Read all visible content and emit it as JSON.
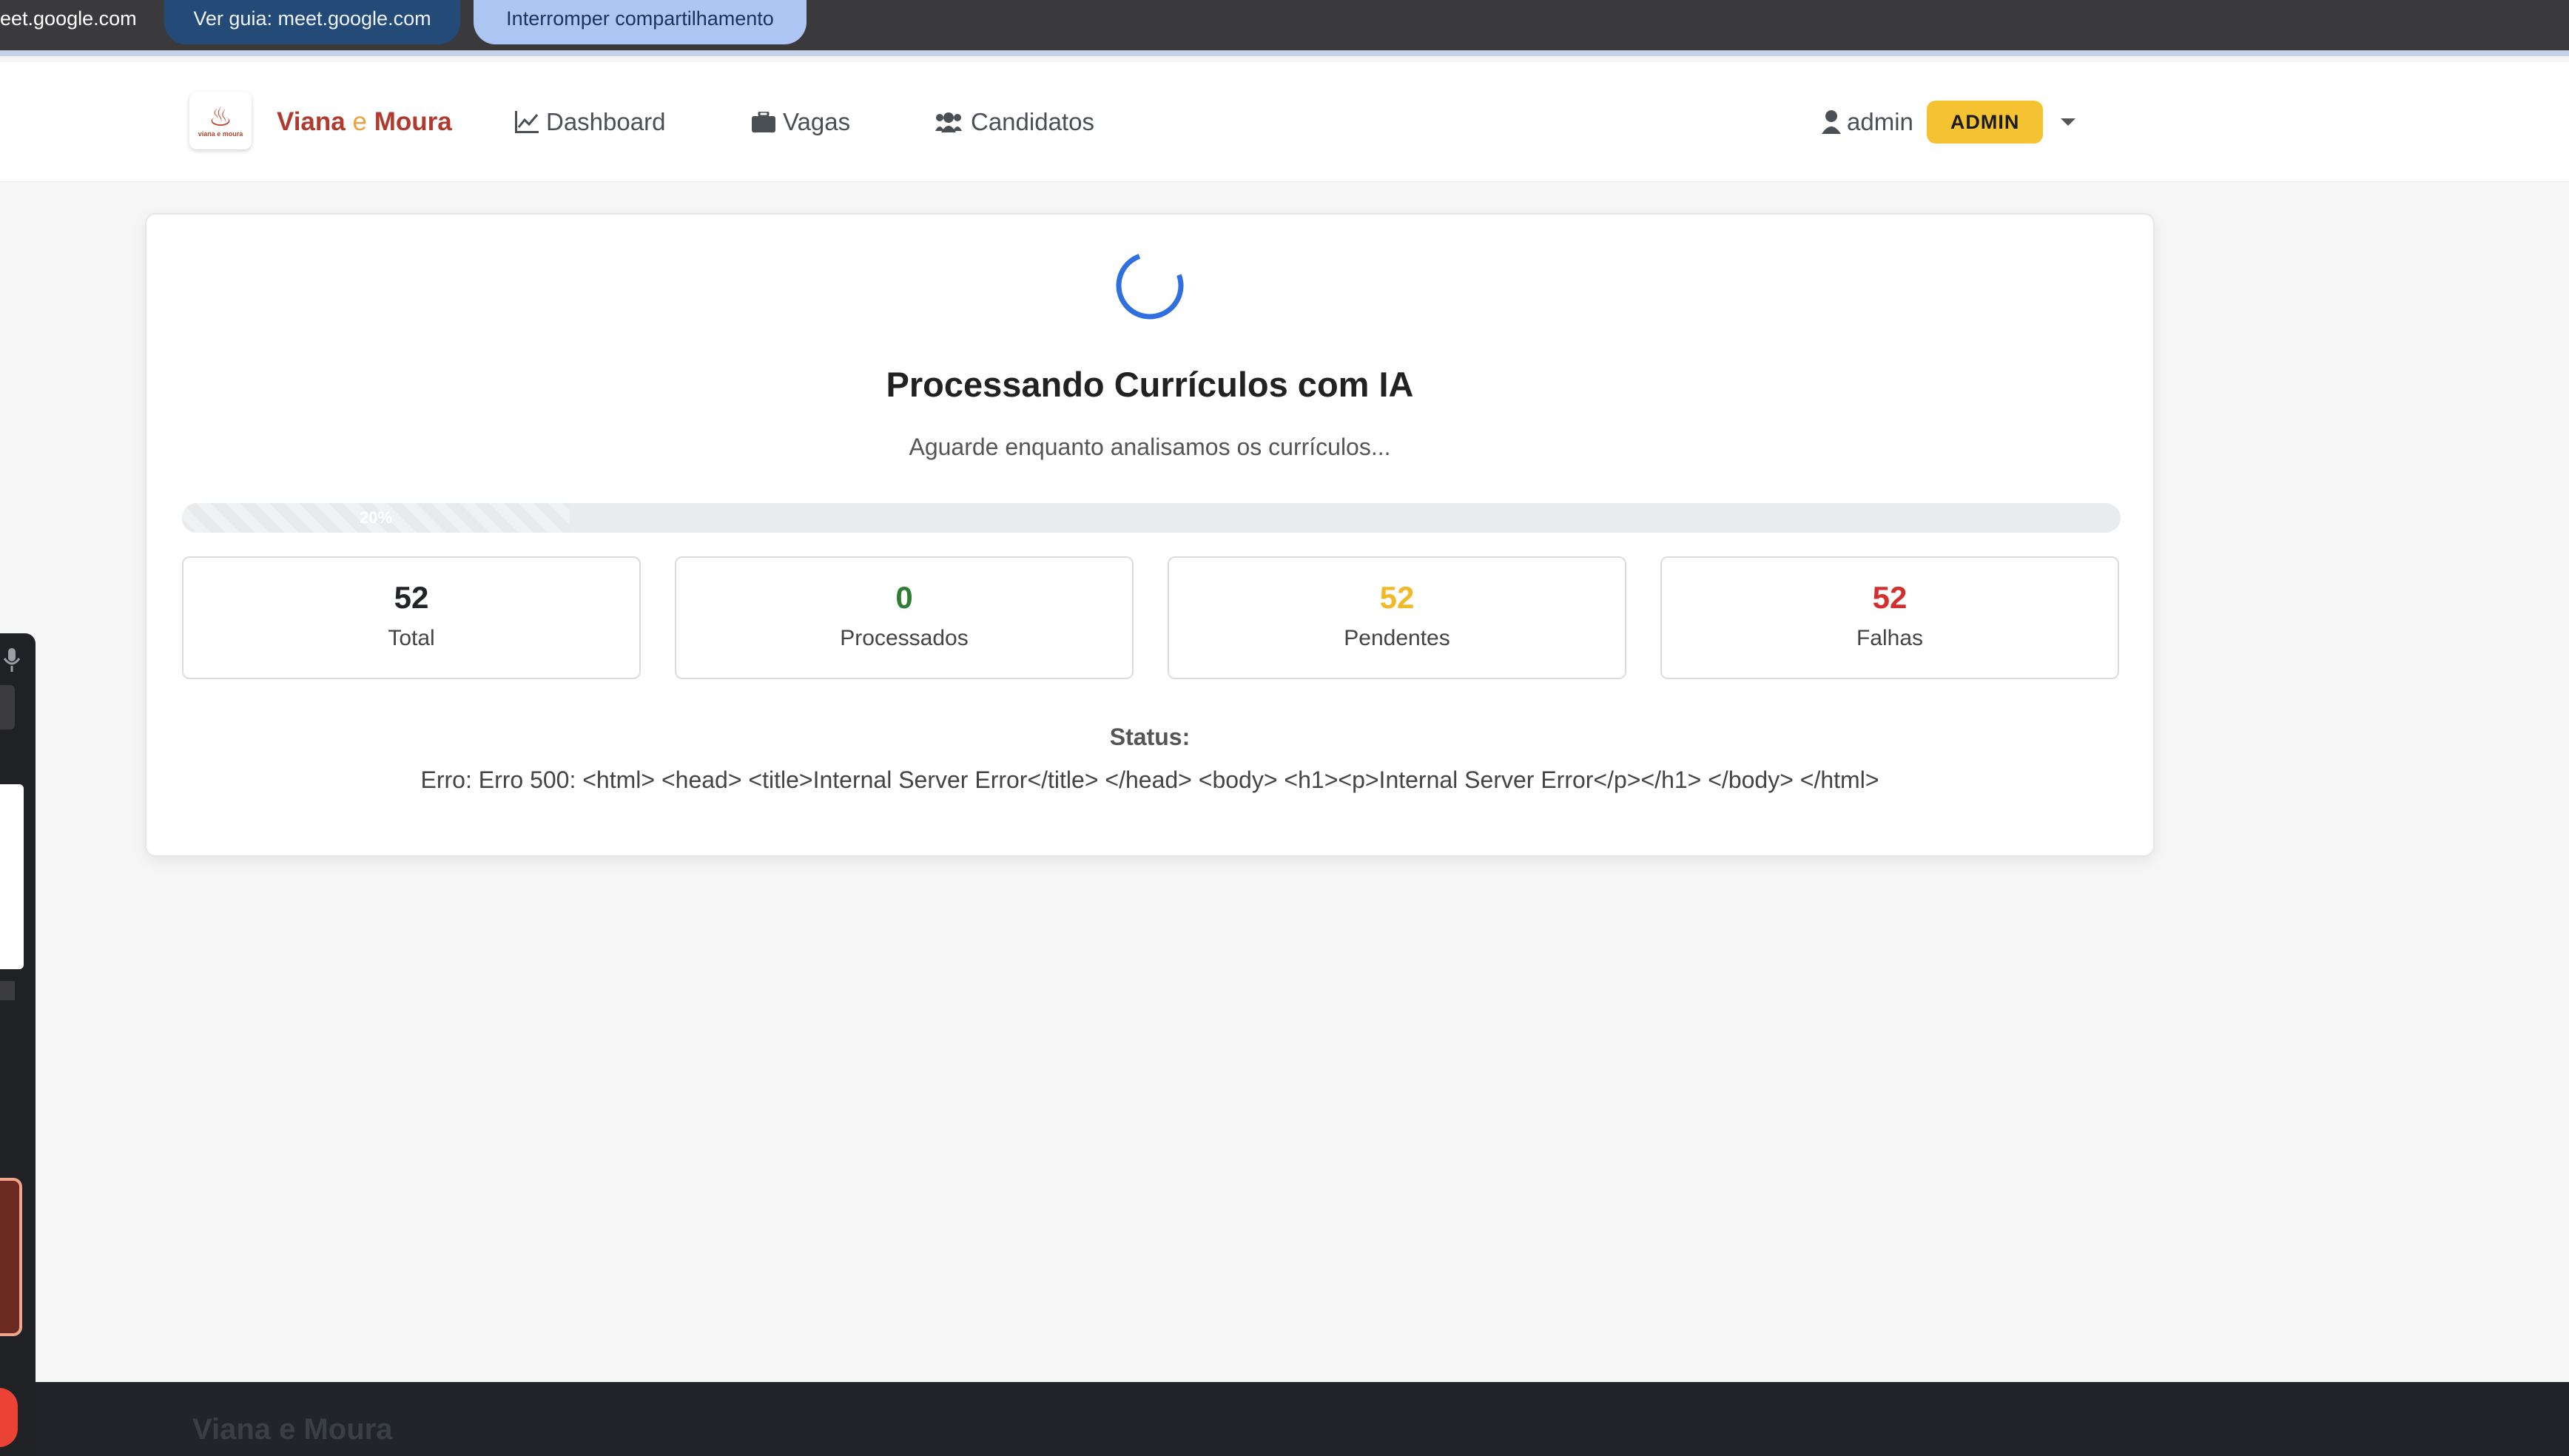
{
  "share_bar": {
    "sharing_text": "eet.google.com",
    "guide_label": "Ver guia: meet.google.com",
    "stop_label": "Interromper compartilhamento"
  },
  "navbar": {
    "logo_text": "viana e moura",
    "brand_part1": "Viana",
    "brand_part2": "e",
    "brand_part3": "Moura",
    "items": [
      {
        "label": "Dashboard",
        "icon": "chart-line-icon"
      },
      {
        "label": "Vagas",
        "icon": "briefcase-icon"
      },
      {
        "label": "Candidatos",
        "icon": "users-icon"
      }
    ],
    "user_name": "admin",
    "role_badge": "ADMIN"
  },
  "processing": {
    "title": "Processando Currículos com IA",
    "subtitle": "Aguarde enquanto analisamos os currículos...",
    "progress_label": "20%",
    "progress_value": 0.2,
    "stats": [
      {
        "value": "52",
        "label": "Total",
        "color": "#212529"
      },
      {
        "value": "0",
        "label": "Processados",
        "color": "#2e7d32"
      },
      {
        "value": "52",
        "label": "Pendentes",
        "color": "#f0b928"
      },
      {
        "value": "52",
        "label": "Falhas",
        "color": "#d32f2f"
      }
    ],
    "status_label": "Status:",
    "status_message": "Erro: Erro 500: <html> <head> <title>Internal Server Error</title> </head> <body> <h1><p>Internal Server Error</p></h1> </body> </html>"
  },
  "footer": {
    "brand": "Viana e Moura"
  },
  "colors": {
    "accent": "#b03a2e",
    "spinner": "#2f6fe0",
    "badge": "#f5c232"
  }
}
